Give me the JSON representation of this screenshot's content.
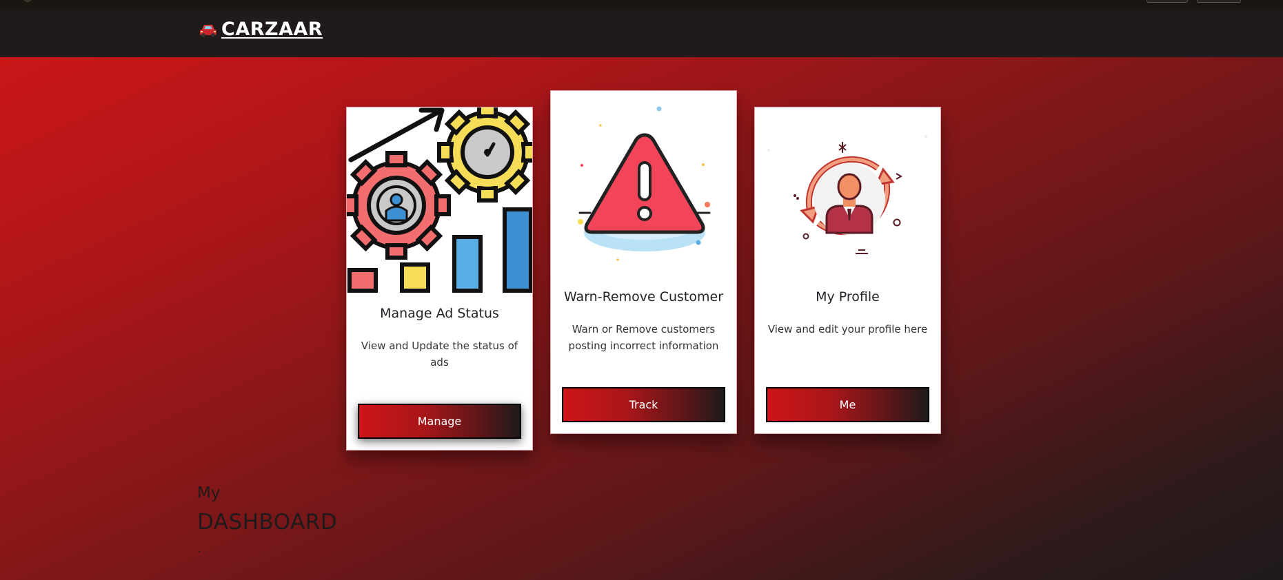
{
  "brand": {
    "name": "CARZAAR",
    "icon": "car-icon"
  },
  "cards": [
    {
      "title": "Manage Ad Status",
      "text": "View and Update the status of ads",
      "button": "Manage",
      "icon": "ad-status-gears-chart-icon"
    },
    {
      "title": "Warn-Remove Customer",
      "text": "Warn or Remove customers posting incorrect information",
      "button": "Track",
      "icon": "warning-triangle-icon"
    },
    {
      "title": "My Profile",
      "text": "View and edit your profile here",
      "button": "Me",
      "icon": "profile-cycle-icon"
    }
  ],
  "dashboard": {
    "prefix": "My",
    "title": "DASHBOARD"
  },
  "colors": {
    "accent_red": "#d01717",
    "dark": "#1f1a1b",
    "navbar": "#211a1a"
  }
}
